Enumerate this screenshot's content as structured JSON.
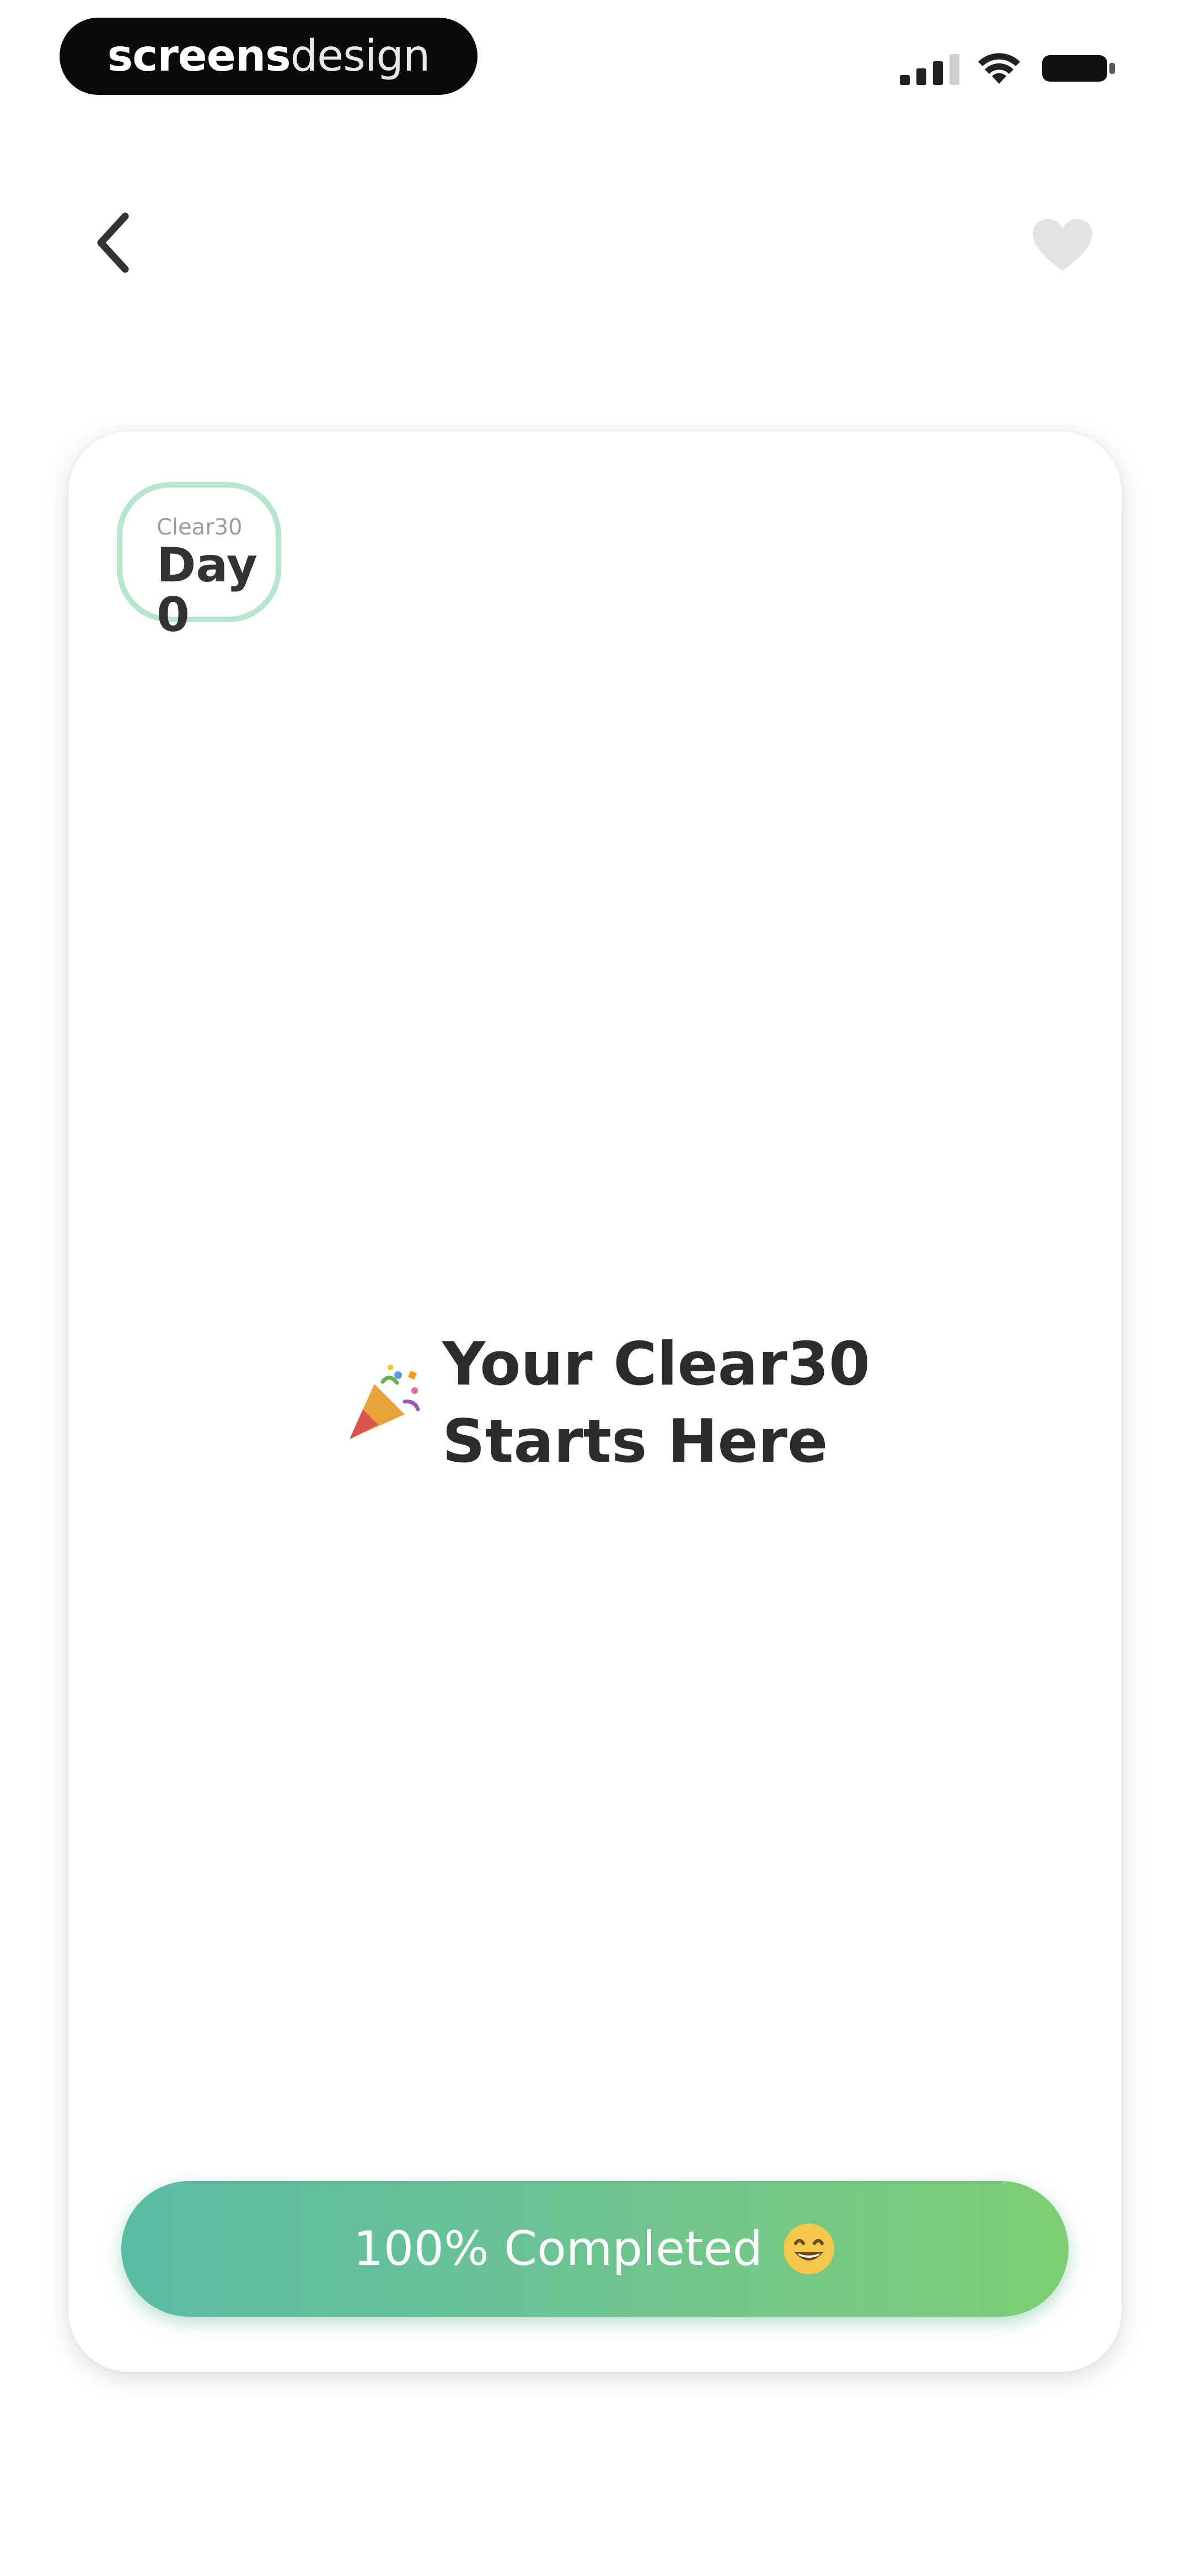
{
  "status_bar": {
    "brand_bold": "screens",
    "brand_light": "design",
    "icons": [
      "signal-icon",
      "wifi-icon",
      "battery-icon"
    ]
  },
  "nav": {
    "back_icon": "chevron-left-icon",
    "favorite_icon": "heart-icon"
  },
  "card": {
    "badge_small": "Clear30",
    "badge_big": "Day 0",
    "headline_icon": "party-popper-icon",
    "headline_line1": "Your Clear30",
    "headline_line2": "Starts Here",
    "progress_label": "100% Completed",
    "progress_value": 1.0,
    "progress_icon": "grinning-face-icon"
  },
  "colors": {
    "accent_start": "#5bbba4",
    "accent_end": "#7dcf73",
    "badge_border": "#b6e6cd",
    "text_dark": "#2c2c2c"
  }
}
